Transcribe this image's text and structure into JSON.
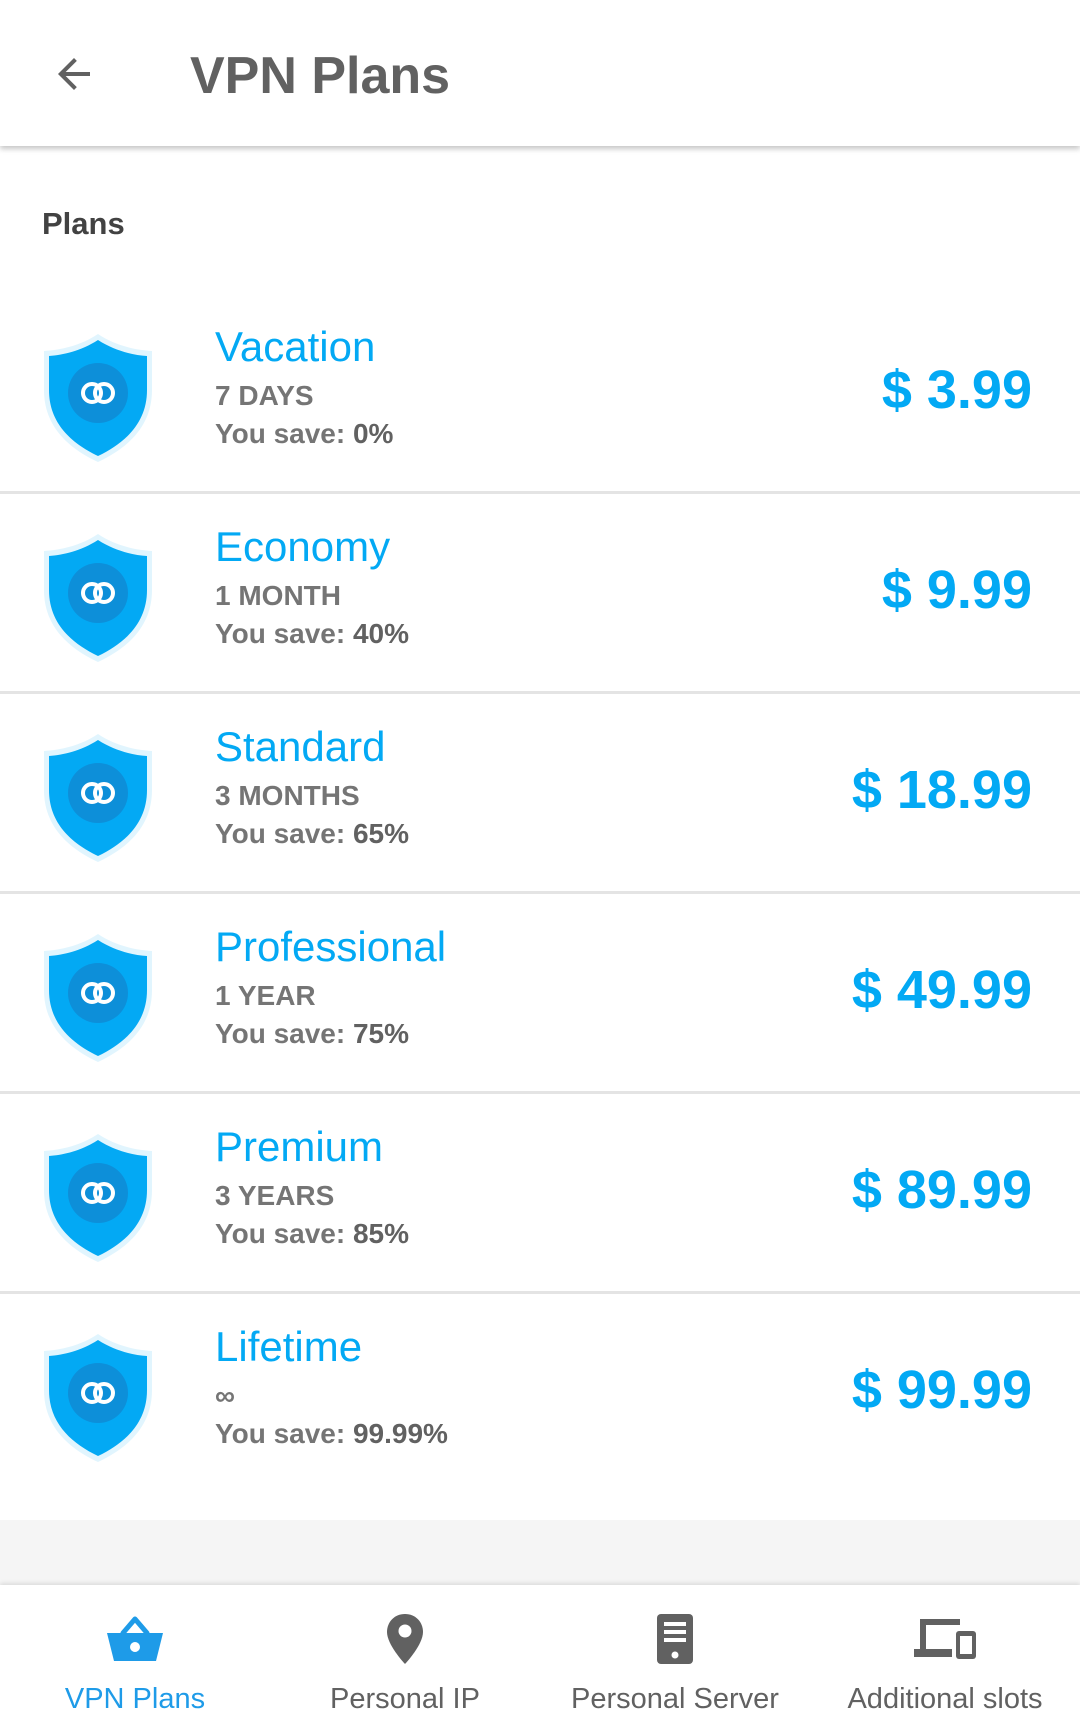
{
  "appbar": {
    "title": "VPN Plans"
  },
  "section": {
    "label": "Plans"
  },
  "plans": [
    {
      "name": "Vacation",
      "duration": "7 DAYS",
      "save_label": "You save:",
      "save_value": "0%",
      "price": "$ 3.99"
    },
    {
      "name": "Economy",
      "duration": "1 MONTH",
      "save_label": "You save:",
      "save_value": "40%",
      "price": "$ 9.99"
    },
    {
      "name": "Standard",
      "duration": "3 MONTHS",
      "save_label": "You save:",
      "save_value": "65%",
      "price": "$ 18.99"
    },
    {
      "name": "Professional",
      "duration": "1 YEAR",
      "save_label": "You save:",
      "save_value": "75%",
      "price": "$ 49.99"
    },
    {
      "name": "Premium",
      "duration": "3 YEARS",
      "save_label": "You save:",
      "save_value": "85%",
      "price": "$ 89.99"
    },
    {
      "name": "Lifetime",
      "duration": "∞",
      "save_label": "You save:",
      "save_value": "99.99%",
      "price": "$ 99.99"
    }
  ],
  "bottom_nav": [
    {
      "label": "VPN Plans",
      "icon": "basket-icon",
      "active": true
    },
    {
      "label": "Personal IP",
      "icon": "location-pin-icon",
      "active": false
    },
    {
      "label": "Personal Server",
      "icon": "server-icon",
      "active": false
    },
    {
      "label": "Additional slots",
      "icon": "devices-icon",
      "active": false
    }
  ],
  "colors": {
    "accent": "#03a9f4",
    "nav_active": "#1e9be8",
    "shield": "#03a9f4",
    "text_secondary": "#757575"
  }
}
